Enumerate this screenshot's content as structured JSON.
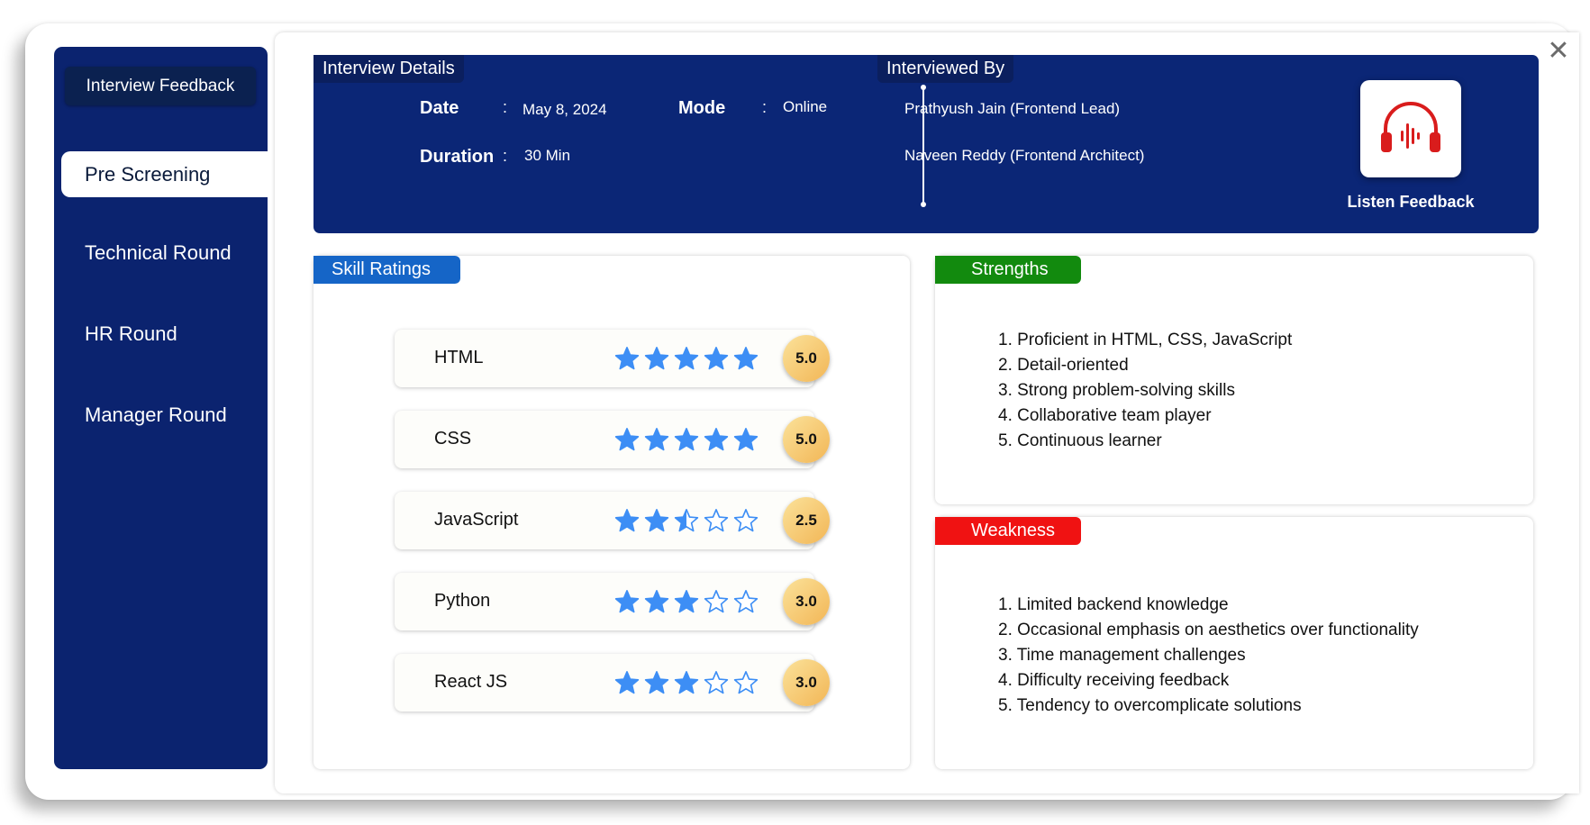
{
  "sidebar": {
    "title": "Interview Feedback",
    "items": [
      {
        "label": "Pre Screening",
        "active": true
      },
      {
        "label": "Technical Round",
        "active": false
      },
      {
        "label": "HR Round",
        "active": false
      },
      {
        "label": "Manager Round",
        "active": false
      }
    ]
  },
  "details": {
    "title": "Interview Details",
    "date_label": "Date",
    "date_value": "May 8, 2024",
    "mode_label": "Mode",
    "mode_value": "Online",
    "duration_label": "Duration",
    "duration_value": "30 Min",
    "separator": ":",
    "interviewed_by_title": "Interviewed By",
    "interviewers": [
      "Prathyush Jain (Frontend Lead)",
      "Naveen Reddy (Frontend Architect)"
    ],
    "listen_label": "Listen Feedback",
    "listen_icon": "headphones-icon"
  },
  "skills": {
    "title": "Skill Ratings",
    "items": [
      {
        "name": "HTML",
        "rating": 5.0,
        "score": "5.0"
      },
      {
        "name": "CSS",
        "rating": 5.0,
        "score": "5.0"
      },
      {
        "name": "JavaScript",
        "rating": 2.5,
        "score": "2.5"
      },
      {
        "name": "Python",
        "rating": 3.0,
        "score": "3.0"
      },
      {
        "name": "React JS",
        "rating": 3.0,
        "score": "3.0"
      }
    ]
  },
  "strengths": {
    "title": "Strengths",
    "items": [
      "1. Proficient in HTML, CSS, JavaScript",
      "2. Detail-oriented",
      "3. Strong problem-solving skills",
      "4. Collaborative team player",
      "5. Continuous learner"
    ]
  },
  "weakness": {
    "title": "Weakness",
    "items": [
      "1. Limited backend knowledge",
      "2. Occasional emphasis on aesthetics over functionality",
      "3. Time management challenges",
      "4. Difficulty receiving feedback",
      "5. Tendency to overcomplicate solutions"
    ]
  },
  "colors": {
    "navy": "#0b2676",
    "sidebar": "#0b236f",
    "star": "#3d8ef5",
    "skills_tab": "#1565c7",
    "strengths_tab": "#128a0e",
    "weakness_tab": "#f01212",
    "headphone": "#d91c1c"
  },
  "close_icon": "close-icon"
}
